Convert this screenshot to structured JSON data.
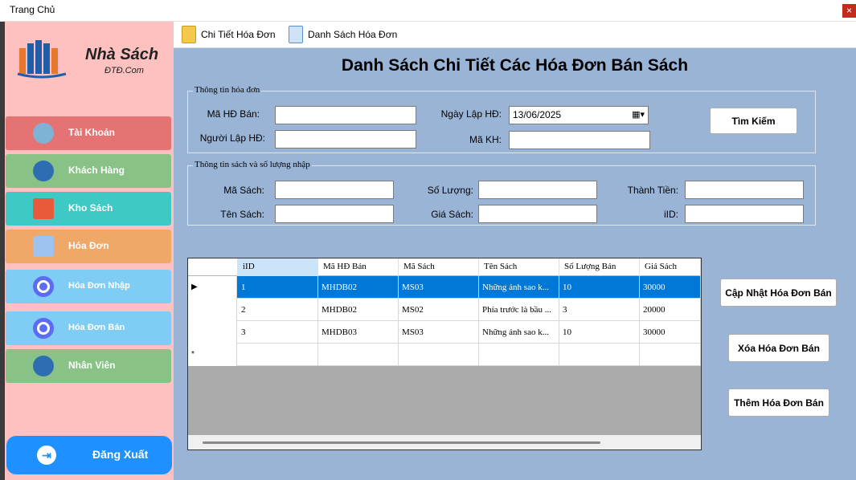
{
  "window": {
    "title": "Trang Chủ",
    "close_glyph": "×"
  },
  "brand": {
    "name": "Nhà Sách",
    "sub": "ĐTĐ.Com"
  },
  "sidebar": {
    "items": [
      {
        "label": "Tài Khoản",
        "color": "#e57373",
        "icon": "user-helmet-icon"
      },
      {
        "label": "Khách Hàng",
        "color": "#88c286",
        "icon": "customer-icon"
      },
      {
        "label": "Kho Sách",
        "color": "#3ec9c4",
        "icon": "book-stack-icon"
      },
      {
        "label": "Hóa Đơn",
        "color": "#f0a868",
        "icon": "invoice-icon"
      },
      {
        "label": "Hóa Đơn Nhập",
        "color": "#7fcdf5",
        "icon": "radio-icon"
      },
      {
        "label": "Hóa Đơn Bán",
        "color": "#7fcdf5",
        "icon": "radio-icon"
      },
      {
        "label": "Nhân Viên",
        "color": "#88c286",
        "icon": "employee-icon"
      }
    ],
    "logout": {
      "label": "Đăng Xuất",
      "icon": "logout-icon"
    }
  },
  "toolbar": {
    "tabs": [
      {
        "label": "Chi Tiết Hóa Đơn",
        "icon": "clipboard-icon"
      },
      {
        "label": "Danh Sách Hóa Đơn",
        "icon": "document-list-icon"
      }
    ]
  },
  "main": {
    "title": "Danh Sách Chi Tiết Các Hóa Đơn Bán Sách",
    "invoice_group": {
      "title": "Thông tin hóa đơn",
      "ma_hd_label": "Mã HĐ Bán:",
      "ma_hd_value": "",
      "nguoi_lap_label": "Người Lập HĐ:",
      "nguoi_lap_value": "",
      "ngay_lap_label": "Ngày Lập HĐ:",
      "ngay_lap_value": "13/06/2025",
      "ma_kh_label": "Mã KH:",
      "ma_kh_value": "",
      "search_button": "Tìm Kiếm"
    },
    "book_group": {
      "title": "Thông tin sách và số lượng nhập",
      "ma_sach_label": "Mã Sách:",
      "ten_sach_label": "Tên Sách:",
      "so_luong_label": "Số Lượng:",
      "gia_sach_label": "Giá Sách:",
      "thanh_tien_label": "Thành Tiền:",
      "iid_label": "iID:"
    },
    "grid": {
      "columns": [
        "iID",
        "Mã HĐ Bán",
        "Mã Sách",
        "Tên Sách",
        "Số Lượng Bán",
        "Giá Sách"
      ],
      "rows": [
        {
          "marker": "▶",
          "cells": [
            "1",
            "MHDB02",
            "MS03",
            "Những ảnh sao k...",
            "10",
            "30000"
          ]
        },
        {
          "marker": "",
          "cells": [
            "2",
            "MHDB02",
            "MS02",
            "Phía trước là bầu ...",
            "3",
            "20000"
          ]
        },
        {
          "marker": "",
          "cells": [
            "3",
            "MHDB03",
            "MS03",
            "Những ảnh sao k...",
            "10",
            "30000"
          ]
        }
      ],
      "new_row_marker": "*"
    },
    "actions": {
      "update": "Cập Nhật Hóa Đơn Bán",
      "delete": "Xóa Hóa Đơn Bán",
      "add": "Thêm Hóa Đơn Bán"
    }
  }
}
